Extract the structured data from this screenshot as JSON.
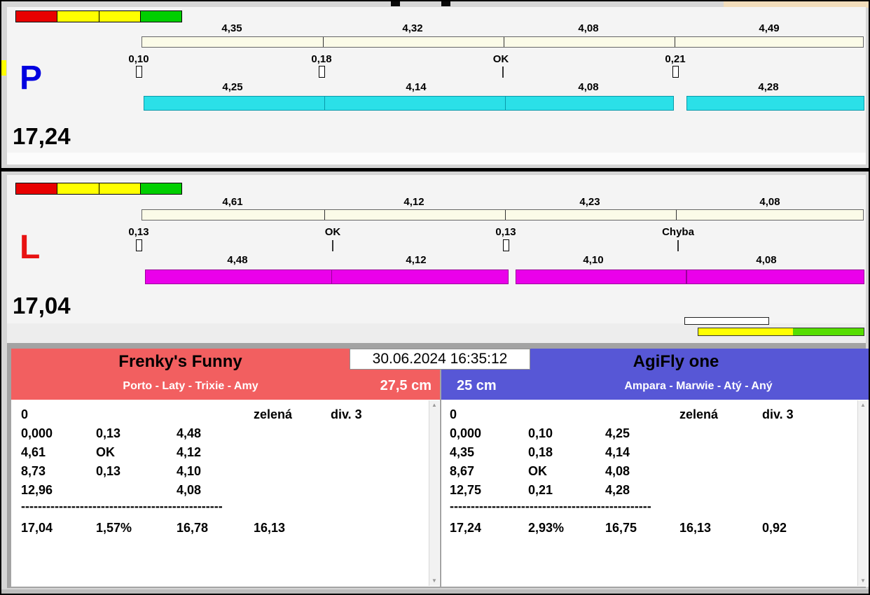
{
  "timestamp": "30.06.2024 16:35:12",
  "icons": {
    "scroll_up": "▲",
    "scroll_down": "▼"
  },
  "colors": {
    "lane_upper_bar": "#fbfbe8",
    "lane_p_bar": "#2be0e8",
    "lane_l_bar": "#ea00ea",
    "traffic_red": "#e80000",
    "traffic_yellow": "#ffff00",
    "traffic_green": "#00cf00",
    "team_left_header": "#f25f60",
    "team_right_header": "#5757d6",
    "letter_p": "#0000e0",
    "letter_l": "#e81212",
    "progress_yellow": "#ffff00",
    "progress_green": "#55dd00"
  },
  "lane_p": {
    "letter": "P",
    "total": "17,24",
    "upper_segments": [
      "4,35",
      "4,32",
      "4,08",
      "4,49"
    ],
    "marks": [
      {
        "label": "0,10"
      },
      {
        "label": "0,18"
      },
      {
        "label": "OK"
      },
      {
        "label": "0,21"
      }
    ],
    "lower_segments": [
      "4,25",
      "4,14",
      "4,08",
      "4,28"
    ]
  },
  "lane_l": {
    "letter": "L",
    "total": "17,04",
    "upper_segments": [
      "4,61",
      "4,12",
      "4,23",
      "4,08"
    ],
    "marks": [
      {
        "label": "0,13"
      },
      {
        "label": "OK"
      },
      {
        "label": "0,13"
      },
      {
        "label": "Chyba"
      }
    ],
    "lower_segments": [
      "4,48",
      "4,12",
      "4,10",
      "4,08"
    ]
  },
  "team_left": {
    "name": "Frenky's Funny",
    "dogs": "Porto - Laty - Trixie - Amy",
    "height": "27,5 cm",
    "run": "0",
    "card": "zelená",
    "division": "div. 3",
    "rows": [
      [
        "0,000",
        "0,13",
        "4,48"
      ],
      [
        "4,61",
        "OK",
        "4,12"
      ],
      [
        "8,73",
        "0,13",
        "4,10"
      ],
      [
        "12,96",
        "",
        "4,08"
      ]
    ],
    "separator": "------------------------------------------------",
    "totals": [
      "17,04",
      "1,57%",
      "16,78",
      "16,13",
      ""
    ]
  },
  "team_right": {
    "name": "AgiFly one",
    "dogs": "Ampara - Marwie - Atý - Aný",
    "height": "25 cm",
    "run": "0",
    "card": "zelená",
    "division": "div. 3",
    "rows": [
      [
        "0,000",
        "0,10",
        "4,25"
      ],
      [
        "4,35",
        "0,18",
        "4,14"
      ],
      [
        "8,67",
        "OK",
        "4,08"
      ],
      [
        "12,75",
        "0,21",
        "4,28"
      ]
    ],
    "separator": "------------------------------------------------",
    "totals": [
      "17,24",
      "2,93%",
      "16,75",
      "16,13",
      "0,92"
    ]
  }
}
